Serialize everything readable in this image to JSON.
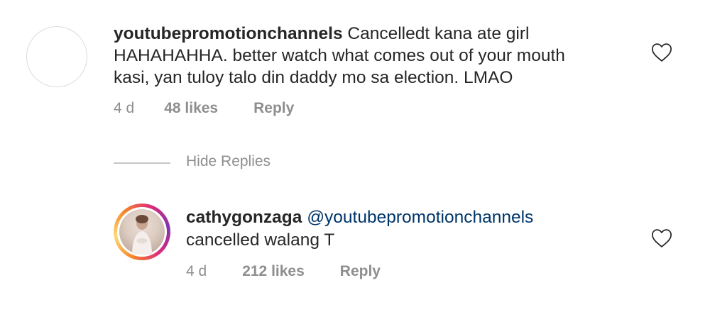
{
  "comments": [
    {
      "username": "youtubepromotionchannels",
      "text_line1": "Cancelledt kana ate girl",
      "text_line2": "HAHAHAHHA. better watch what comes out of your mouth",
      "text_line3": "kasi, yan tuloy talo din daddy mo sa election. LMAO",
      "age": "4 d",
      "likes": "48 likes",
      "reply": "Reply"
    },
    {
      "username": "cathygonzaga",
      "mention": "@youtubepromotionchannels",
      "text_line2": "cancelled walang T",
      "age": "4 d",
      "likes": "212 likes",
      "reply": "Reply"
    }
  ],
  "hide_replies": "Hide Replies",
  "icons": {
    "like": "heart-outline-icon"
  },
  "colors": {
    "text": "#262626",
    "secondary": "#8e8e8e",
    "mention": "#003569",
    "avatar_ring": "instagram-gradient"
  }
}
